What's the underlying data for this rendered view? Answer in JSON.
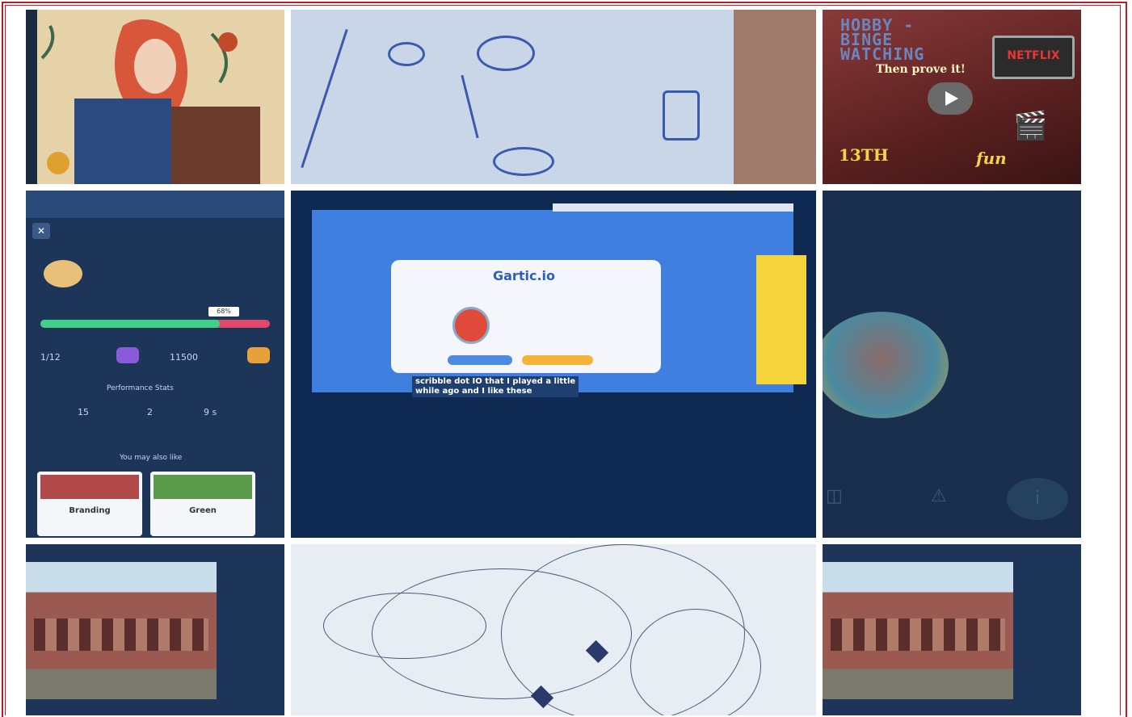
{
  "gallery": {
    "tiles": [
      {
        "id": "t1",
        "label": "Illustrated girl with flowers artwork"
      },
      {
        "id": "t2",
        "label": "Blue pen portrait sketch"
      },
      {
        "id": "t3",
        "label": "Netflix binge watching poster"
      },
      {
        "id": "t4",
        "label": "Quiz app screenshot"
      },
      {
        "id": "t5",
        "label": "Online game screenshot"
      },
      {
        "id": "t6",
        "label": "Video call screenshot"
      },
      {
        "id": "t7",
        "label": "School building photo"
      },
      {
        "id": "t8",
        "label": "Pencil sketch"
      },
      {
        "id": "t9",
        "label": "School building photo"
      }
    ]
  },
  "poster": {
    "title_line1": "HOBBY -",
    "title_line2": "BINGE",
    "title_line3": "WATCHING",
    "logo": "NETFLIX",
    "tagline": "Then prove it!",
    "date": "13TH",
    "fun": "fun"
  },
  "quiz": {
    "progress_pct": "68%",
    "progress_value": 0.78,
    "stat1": "1/12",
    "stat2": "11500",
    "section": "Performance Stats",
    "perf1": "15",
    "perf2": "2",
    "perf3": "9 s",
    "suggest": "You may also like",
    "card1": "Branding",
    "card2": "Green"
  },
  "game": {
    "logo": "Gartic.io",
    "caption_line1": "scribble dot IO that I played a little",
    "caption_line2": "while ago and I like these"
  },
  "colors": {
    "frame": "#b81d24",
    "accent_green": "#3fd08a",
    "accent_pink": "#e04a6a"
  }
}
